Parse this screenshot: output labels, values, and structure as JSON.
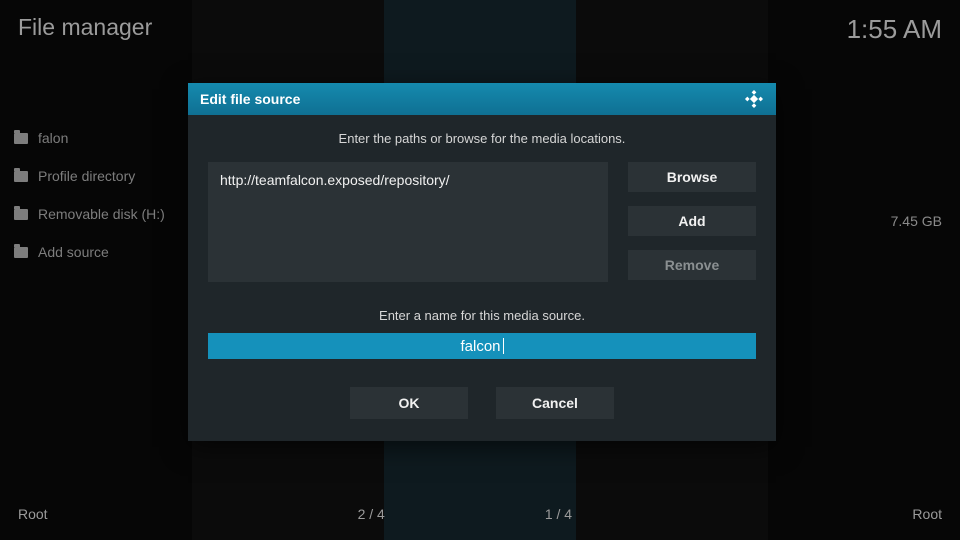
{
  "header": {
    "title": "File manager",
    "clock": "1:55 AM"
  },
  "left_panel": {
    "items": [
      {
        "label": "falon"
      },
      {
        "label": "Profile directory"
      },
      {
        "label": "Removable disk (H:)"
      },
      {
        "label": "Add source"
      }
    ]
  },
  "right_info": {
    "disk_size": "7.45 GB"
  },
  "footer": {
    "left_label": "Root",
    "count_a": "2 / 4",
    "count_b": "1 / 4",
    "right_label": "Root"
  },
  "dialog": {
    "title": "Edit file source",
    "instruction": "Enter the paths or browse for the media locations.",
    "path_value": "http://teamfalcon.exposed/repository/",
    "buttons": {
      "browse": "Browse",
      "add": "Add",
      "remove": "Remove"
    },
    "name_label": "Enter a name for this media source.",
    "name_value": "falcon",
    "ok_label": "OK",
    "cancel_label": "Cancel"
  }
}
